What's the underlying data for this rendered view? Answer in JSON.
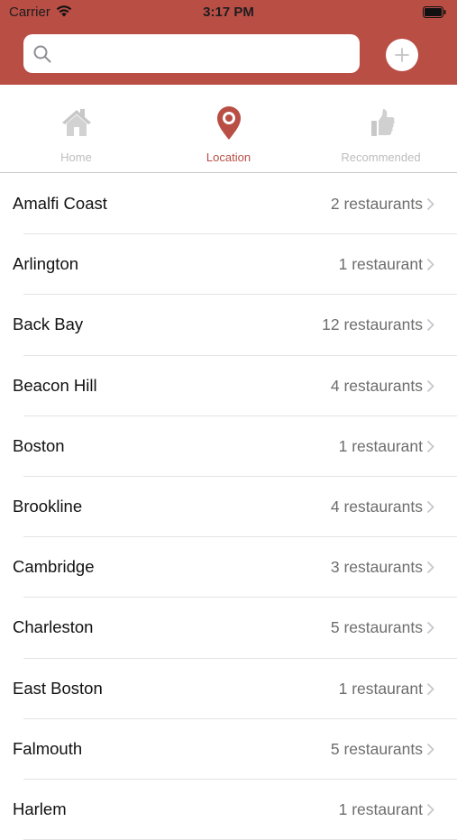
{
  "status_bar": {
    "carrier": "Carrier",
    "time": "3:17 PM"
  },
  "search": {
    "placeholder": "",
    "value": ""
  },
  "colors": {
    "accent": "#b94e45",
    "inactive": "#bdbdbd"
  },
  "tabs": [
    {
      "label": "Home",
      "icon": "home-icon",
      "active": false
    },
    {
      "label": "Location",
      "icon": "location-pin-icon",
      "active": true
    },
    {
      "label": "Recommended",
      "icon": "thumbs-up-icon",
      "active": false
    }
  ],
  "locations": [
    {
      "name": "Amalfi Coast",
      "count": "2 restaurants"
    },
    {
      "name": "Arlington",
      "count": "1 restaurant"
    },
    {
      "name": "Back Bay",
      "count": "12 restaurants"
    },
    {
      "name": "Beacon Hill",
      "count": "4 restaurants"
    },
    {
      "name": "Boston",
      "count": "1 restaurant"
    },
    {
      "name": "Brookline",
      "count": "4 restaurants"
    },
    {
      "name": "Cambridge",
      "count": "3 restaurants"
    },
    {
      "name": "Charleston",
      "count": "5 restaurants"
    },
    {
      "name": "East Boston",
      "count": "1 restaurant"
    },
    {
      "name": "Falmouth",
      "count": "5 restaurants"
    },
    {
      "name": "Harlem",
      "count": "1 restaurant"
    }
  ]
}
